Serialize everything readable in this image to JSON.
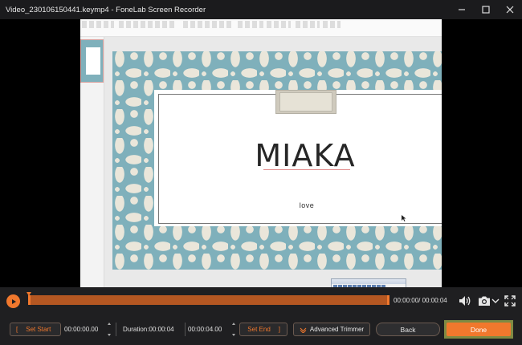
{
  "window": {
    "title": "Video_230106150441.keymp4 - FoneLab Screen Recorder",
    "controls": [
      "minimize",
      "maximize",
      "close"
    ]
  },
  "slide": {
    "title": "MIAKA",
    "subtitle": "love"
  },
  "player": {
    "timecode": "00:00:00/ 00:00:04",
    "progress": 0.0
  },
  "editbar": {
    "set_start_bracket": "[",
    "set_start_label": "Set Start",
    "start_time": "00:00:00.00",
    "duration": "Duration:00:00:04",
    "end_time": "00:00:04.00",
    "set_end_label": "Set End",
    "set_end_bracket": "]",
    "advanced_trimmer_label": "Advanced Trimmer",
    "back_label": "Back",
    "done_label": "Done"
  },
  "colors": {
    "accent": "#f0782d",
    "track": "#b45722",
    "background": "#1f1f21",
    "done_highlight": "#7f8a43"
  },
  "icons": [
    "minimize-icon",
    "maximize-icon",
    "close-icon",
    "play-icon",
    "volume-icon",
    "camera-icon",
    "chevron-down-icon",
    "fullscreen-icon",
    "trimmer-icon"
  ]
}
